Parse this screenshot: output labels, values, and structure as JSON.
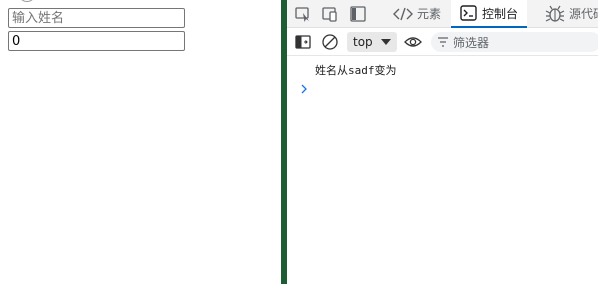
{
  "app": {
    "name_input": {
      "placeholder": "输入姓名",
      "value": ""
    },
    "age_input": {
      "value": "0"
    }
  },
  "devtools": {
    "tabs": [
      {
        "label": "元素",
        "icon": "code-icon"
      },
      {
        "label": "控制台",
        "icon": "console-icon",
        "active": true
      },
      {
        "label": "源代码",
        "icon": "bug-icon"
      }
    ],
    "toolbar": {
      "context": "top",
      "filter_placeholder": "筛选器"
    },
    "console": {
      "messages": [
        "姓名从sadf变为"
      ]
    }
  },
  "colors": {
    "splitter": "#1e5c34",
    "active_tab_underline": "#0067c0"
  }
}
